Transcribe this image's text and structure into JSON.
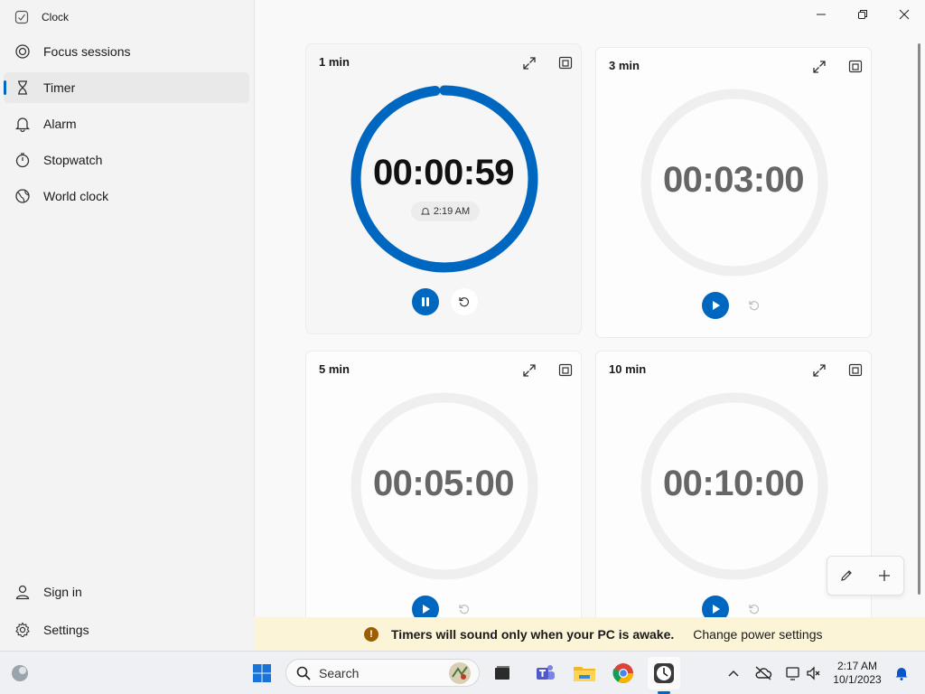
{
  "app": {
    "title": "Clock"
  },
  "sidebar": {
    "items": [
      {
        "label": "Focus sessions",
        "icon": "focus-icon"
      },
      {
        "label": "Timer",
        "icon": "hourglass-icon",
        "active": true
      },
      {
        "label": "Alarm",
        "icon": "bell-icon"
      },
      {
        "label": "Stopwatch",
        "icon": "stopwatch-icon"
      },
      {
        "label": "World clock",
        "icon": "globe-icon"
      }
    ],
    "footer": [
      {
        "label": "Sign in",
        "icon": "person-icon"
      },
      {
        "label": "Settings",
        "icon": "gear-icon"
      }
    ]
  },
  "timers": [
    {
      "name": "1 min",
      "time": "00:00:59",
      "running": true,
      "alarm_time": "2:19 AM",
      "progress": 0.983
    },
    {
      "name": "3 min",
      "time": "00:03:00",
      "running": false
    },
    {
      "name": "5 min",
      "time": "00:05:00",
      "running": false
    },
    {
      "name": "10 min",
      "time": "00:10:00",
      "running": false
    }
  ],
  "banner": {
    "message": "Timers will sound only when your PC is awake.",
    "link": "Change power settings"
  },
  "taskbar": {
    "search_placeholder": "Search",
    "time": "2:17 AM",
    "date": "10/1/2023"
  },
  "colors": {
    "accent": "#0067c0",
    "warning": "#9d5d00",
    "banner_bg": "#fcf4d6"
  }
}
